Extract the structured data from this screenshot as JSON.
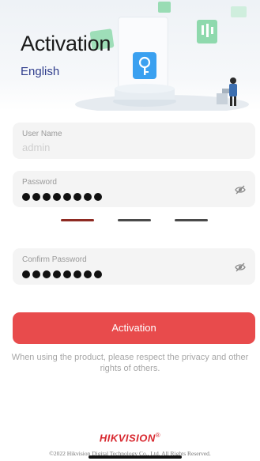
{
  "header": {
    "title": "Activation",
    "language": "English"
  },
  "form": {
    "username": {
      "label": "User Name",
      "placeholder": "admin",
      "value": ""
    },
    "password": {
      "label": "Password",
      "masked_length": 8
    },
    "confirm_password": {
      "label": "Confirm Password",
      "masked_length": 8
    },
    "strength_bars": [
      {
        "color": "#8e2a22",
        "active": true
      },
      {
        "color": "#4a4a4a",
        "active": false
      },
      {
        "color": "#4a4a4a",
        "active": false
      }
    ]
  },
  "actions": {
    "activation_label": "Activation"
  },
  "notice": "When using the product, please respect the privacy and other rights of others.",
  "footer": {
    "brand": "HIKVISION",
    "brand_mark": "®",
    "copyright": "©2022 Hikvision Digital Technology Co., Ltd. All Rights Reserved."
  },
  "colors": {
    "accent": "#e84b4c",
    "brand": "#d8282f",
    "language_link": "#2f3d8c",
    "illustration_green": "#8fd9ad",
    "illustration_blue": "#3aa0f0"
  }
}
